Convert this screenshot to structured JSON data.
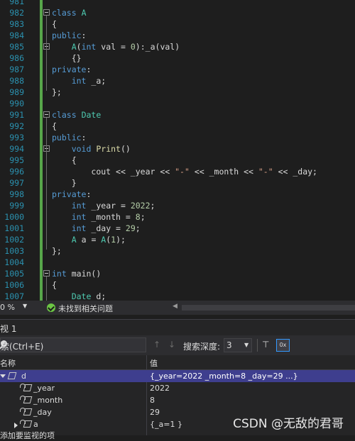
{
  "editor": {
    "lines": [
      {
        "num": "981",
        "code": ""
      },
      {
        "num": "982",
        "code": "class A"
      },
      {
        "num": "983",
        "code": "{"
      },
      {
        "num": "984",
        "code": "public:"
      },
      {
        "num": "985",
        "code": "    A(int val = 0):_a(val)"
      },
      {
        "num": "986",
        "code": "    {}"
      },
      {
        "num": "987",
        "code": "private:"
      },
      {
        "num": "988",
        "code": "    int _a;"
      },
      {
        "num": "989",
        "code": "};"
      },
      {
        "num": "990",
        "code": ""
      },
      {
        "num": "991",
        "code": "class Date"
      },
      {
        "num": "992",
        "code": "{"
      },
      {
        "num": "993",
        "code": "public:"
      },
      {
        "num": "994",
        "code": "    void Print()"
      },
      {
        "num": "995",
        "code": "    {"
      },
      {
        "num": "996",
        "code": "        cout << _year << \"-\" << _month << \"-\" << _day;"
      },
      {
        "num": "997",
        "code": "    }"
      },
      {
        "num": "998",
        "code": "private:"
      },
      {
        "num": "999",
        "code": "    int _year = 2022;"
      },
      {
        "num": "1000",
        "code": "    int _month = 8;"
      },
      {
        "num": "1001",
        "code": "    int _day = 29;"
      },
      {
        "num": "1002",
        "code": "    A a = A(1);"
      },
      {
        "num": "1003",
        "code": "};"
      },
      {
        "num": "1004",
        "code": ""
      },
      {
        "num": "1005",
        "code": "int main()"
      },
      {
        "num": "1006",
        "code": "{"
      },
      {
        "num": "1007",
        "code": "    Date d;"
      }
    ]
  },
  "status": {
    "zoom": "0 %",
    "issues_text": "未找到相关问题"
  },
  "panel": {
    "title": "视 1"
  },
  "toolbar": {
    "search_placeholder": "索(Ctrl+E)",
    "depth_label": "搜索深度:",
    "depth_value": "3",
    "hex_label": "0x"
  },
  "grid": {
    "col_name": "名称",
    "col_value": "值",
    "rows": [
      {
        "name": "d",
        "value": "{_year=2022 _month=8 _day=29 ...}",
        "selected": true
      },
      {
        "name": "_year",
        "value": "2022"
      },
      {
        "name": "_month",
        "value": "8"
      },
      {
        "name": "_day",
        "value": "29"
      },
      {
        "name": "a",
        "value": "{_a=1 }"
      }
    ],
    "add_watch": "添加要监视的项"
  },
  "watermark": "CSDN @无敌的君哥",
  "colors": {
    "keyword": "#569cd6",
    "type": "#4ec9b0",
    "function": "#dcdcaa",
    "number": "#b5cea8",
    "string": "#d69d85",
    "line_number": "#2b91af",
    "selection": "#3e3e8e"
  }
}
